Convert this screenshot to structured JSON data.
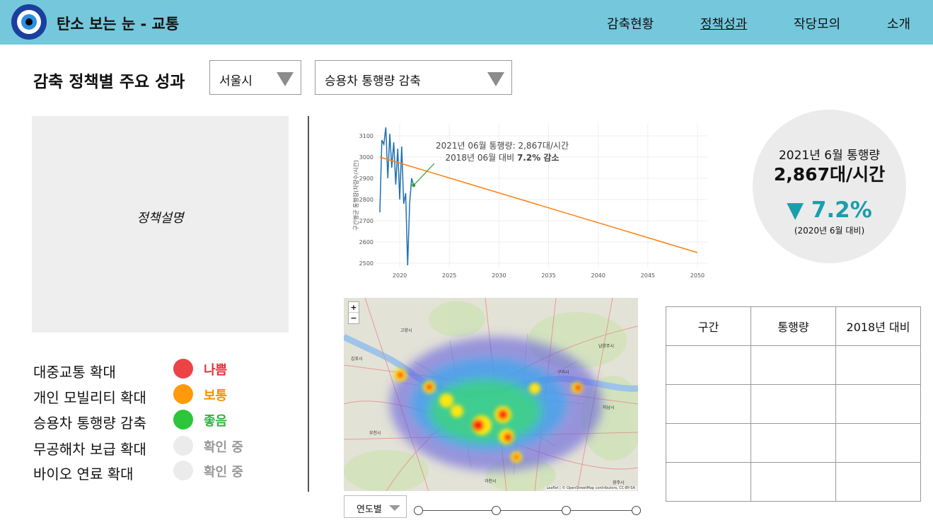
{
  "app": {
    "title": "탄소 보는 눈 - 교통",
    "logo_icon": "evil-eye-icon"
  },
  "nav": [
    {
      "label": "감축현황",
      "active": false
    },
    {
      "label": "정책성과",
      "active": true
    },
    {
      "label": "작당모의",
      "active": false
    },
    {
      "label": "소개",
      "active": false
    }
  ],
  "page": {
    "title": "감축 정책별 주요 성과",
    "region_select": "서울시",
    "policy_select": "승용차 통행량 감축",
    "description_placeholder": "정책설명"
  },
  "policies": [
    {
      "name": "대중교통 확대",
      "status": "나쁨",
      "color": "#ec4347",
      "text_color": "#e8303a"
    },
    {
      "name": "개인 모빌리티 확대",
      "status": "보통",
      "color": "#fe9a0b",
      "text_color": "#f39200"
    },
    {
      "name": "승용차 통행량 감축",
      "status": "좋음",
      "color": "#2dc53a",
      "text_color": "#2fb33a"
    },
    {
      "name": "무공해차 보급 확대",
      "status": "확인 중",
      "color": "#ebebeb",
      "text_color": "#9a9a9a"
    },
    {
      "name": "바이오 연료 확대",
      "status": "확인 중",
      "color": "#ebebeb",
      "text_color": "#9a9a9a"
    }
  ],
  "chart_data": {
    "type": "line",
    "title": "",
    "ylabel": "구간평균 통행량(차량수/시간)",
    "xlabel": "",
    "xlim": [
      2017.5,
      2051
    ],
    "ylim": [
      2480,
      3160
    ],
    "x_ticks": [
      2020,
      2025,
      2030,
      2035,
      2040,
      2045,
      2050
    ],
    "y_ticks": [
      2500,
      2600,
      2700,
      2800,
      2900,
      3000,
      3100
    ],
    "grid": true,
    "series": [
      {
        "color": "#1f6fad",
        "x": [
          2018.0,
          2018.2,
          2018.4,
          2018.6,
          2018.8,
          2019.0,
          2019.2,
          2019.4,
          2019.6,
          2019.8,
          2020.0,
          2020.2,
          2020.4,
          2020.6,
          2020.8,
          2021.0,
          2021.2,
          2021.4
        ],
        "y": [
          2740,
          3080,
          3060,
          3140,
          2900,
          3110,
          2950,
          3070,
          2870,
          3040,
          2800,
          3050,
          2780,
          2830,
          2490,
          2780,
          2900,
          2867
        ]
      },
      {
        "color": "#ff7f0e",
        "x": [
          2018.0,
          2050.0
        ],
        "y": [
          3000,
          2550
        ]
      }
    ],
    "annotation": {
      "line1": "2021년 06월 통행량: 2,867대/시간",
      "line2_prefix": "2018년 06월 대비 ",
      "line2_bold": "7.2% 감소",
      "point": {
        "x": 2021.4,
        "y": 2867
      },
      "arrow_color": "#2ca02c"
    }
  },
  "kpi": {
    "label": "2021년 6월 통행량",
    "value": "2,867대/시간",
    "change": "▼ 7.2%",
    "note": "(2020년 6월 대비)"
  },
  "map": {
    "zoom_in": "+",
    "zoom_out": "−",
    "attribution": "Leaflet | © OpenStreetMap contributors, CC-BY-SA",
    "place_labels": [
      "고양시",
      "김포시",
      "부천시",
      "구리시",
      "하남시",
      "남양주시",
      "과천시",
      "광주시"
    ]
  },
  "controls": {
    "year_mode": "연도별",
    "slider_steps": 4
  },
  "table": {
    "headers": [
      "구간",
      "통행량",
      "2018년 대비"
    ],
    "rows": [
      [
        "",
        "",
        ""
      ],
      [
        "",
        "",
        ""
      ],
      [
        "",
        "",
        ""
      ],
      [
        "",
        "",
        ""
      ]
    ]
  }
}
